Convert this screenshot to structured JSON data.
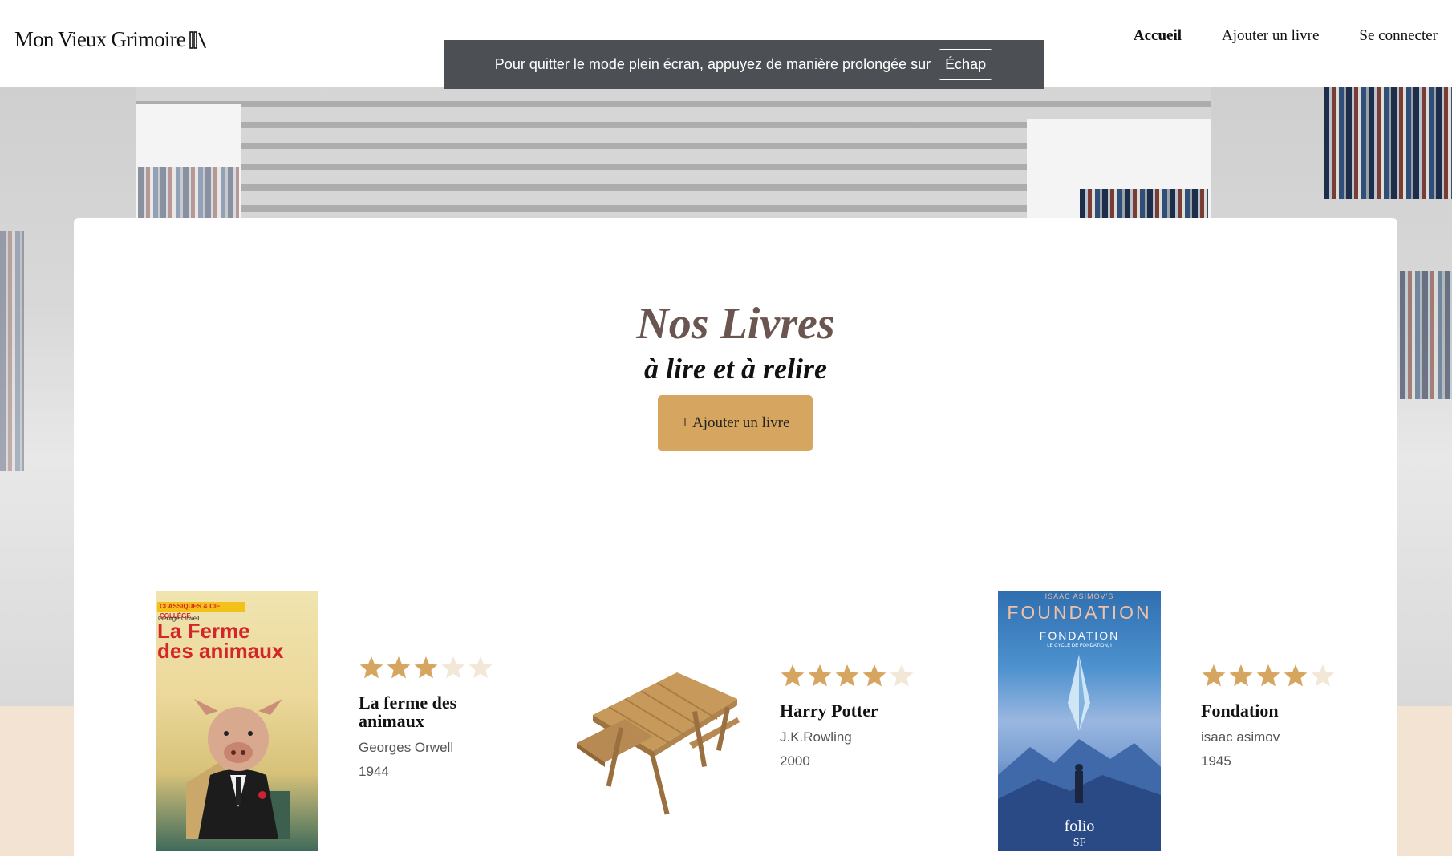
{
  "header": {
    "logo": "Mon Vieux Grimoire",
    "nav": [
      "Accueil",
      "Ajouter un livre",
      "Se connecter"
    ]
  },
  "toast": {
    "message": "Pour quitter le mode plein écran, appuyez de manière prolongée sur",
    "key": "Échap"
  },
  "main": {
    "title": "Nos Livres",
    "subtitle": "à lire et à relire",
    "add_button": "+ Ajouter un livre"
  },
  "books": [
    {
      "title": "La ferme des animaux",
      "author": "Georges Orwell",
      "year": "1944",
      "rating": 3,
      "cover_text": {
        "band": "CLASSIQUES & CIE COLLÈGE",
        "author": "George Orwell",
        "title": "La Ferme des animaux"
      }
    },
    {
      "title": "Harry Potter",
      "author": "J.K.Rowling",
      "year": "2000",
      "rating": 4
    },
    {
      "title": "Fondation",
      "author": "isaac asimov",
      "year": "1945",
      "rating": 4,
      "cover_text": {
        "series": "ISAAC ASIMOV'S",
        "title_en": "FOUNDATION",
        "title_fr": "FONDATION",
        "cycle": "LE CYCLE DE FONDATION, I",
        "publisher": "folio",
        "collection": "SF"
      }
    }
  ],
  "colors": {
    "accent": "#d6a660",
    "star_filled": "#d6a660",
    "star_empty": "#f3e7d8",
    "title_brown": "#6b5550",
    "beige": "#f2e3d3",
    "toast_bg": "#4c5054"
  }
}
